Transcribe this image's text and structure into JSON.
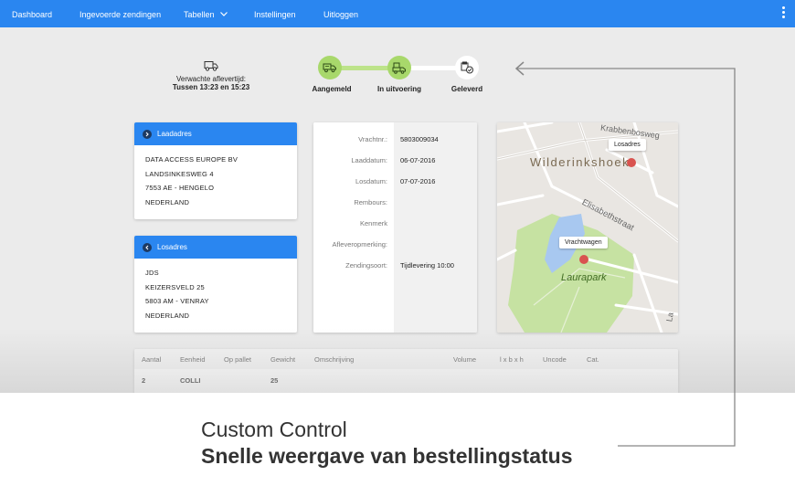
{
  "nav": {
    "items": [
      "Dashboard",
      "Ingevoerde zendingen",
      "Tabellen",
      "Instellingen",
      "Uitloggen"
    ]
  },
  "tracker": {
    "eta_label": "Verwachte aflevertijd:",
    "eta_value": "Tussen 13:23 en 15:23",
    "steps": [
      {
        "label": "Aangemeld",
        "status": "done"
      },
      {
        "label": "In uitvoering",
        "status": "done"
      },
      {
        "label": "Geleverd",
        "status": "todo"
      }
    ]
  },
  "laadadres": {
    "title": "Laadadres",
    "lines": [
      "DATA ACCESS EUROPE BV",
      "LANDSINKESWEG 4",
      "7553 AE - HENGELO",
      "NEDERLAND"
    ]
  },
  "losadres": {
    "title": "Losadres",
    "lines": [
      "JDS",
      "KEIZERSVELD 25",
      "5803 AM - VENRAY",
      "NEDERLAND"
    ]
  },
  "details": {
    "rows": [
      {
        "label": "Vrachtnr.:",
        "value": "5803009034"
      },
      {
        "label": "Laaddatum:",
        "value": "06-07-2016"
      },
      {
        "label": "Losdatum:",
        "value": "07-07-2016"
      },
      {
        "label": "Rembours:",
        "value": ""
      },
      {
        "label": "Kenmerk",
        "value": ""
      },
      {
        "label": "Afleveropmerking:",
        "value": ""
      },
      {
        "label": "Zendingsoort:",
        "value": "Tijdlevering 10:00"
      }
    ]
  },
  "map": {
    "labels": {
      "area_top": "Wilderinkshoek",
      "street_top": "Krabbenbosweg",
      "street_mid": "Elisabethstraat",
      "park": "Laurapark",
      "street_right": "La"
    },
    "tooltips": {
      "losadres": "Losadres",
      "vrachtwagen": "Vrachtwagen"
    },
    "colors": {
      "pin": "#d9534f",
      "park": "#c6e2a2",
      "water": "#a8c8f0"
    }
  },
  "table": {
    "headers": [
      "Aantal",
      "Eenheid",
      "Op pallet",
      "Gewicht",
      "Omschrijving",
      "Volume",
      "l x b x h",
      "Uncode",
      "Cat."
    ],
    "rows": [
      {
        "aantal": "2",
        "eenheid": "COLLI",
        "gewicht": "25"
      }
    ]
  },
  "caption": {
    "title": "Custom Control",
    "subtitle": "Snelle weergave van bestellingstatus"
  },
  "colors": {
    "accent": "#2a86f0",
    "step_done": "#a8d86b"
  }
}
